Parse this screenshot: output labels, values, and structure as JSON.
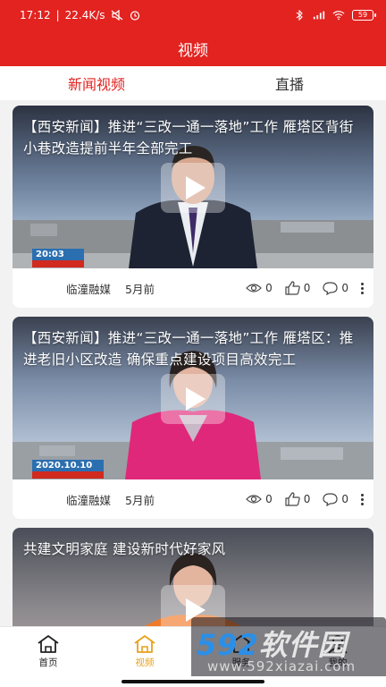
{
  "status_bar": {
    "time": "17:12",
    "speed": "22.4K/s",
    "battery": "59"
  },
  "header": {
    "title": "视频"
  },
  "tabs": [
    {
      "label": "新闻视频",
      "active": true
    },
    {
      "label": "直播",
      "active": false
    }
  ],
  "feed": [
    {
      "title": "【西安新闻】推进“三改一通一落地”工作 雁塔区背街小巷改造提前半年全部完工",
      "overlay_date": "20:03",
      "source": "临潼融媒",
      "time": "5月前",
      "views": "0",
      "likes": "0",
      "comments": "0"
    },
    {
      "title": "【西安新闻】推进“三改一通一落地”工作 雁塔区：推进老旧小区改造 确保重点建设项目高效完工",
      "overlay_date": "2020.10.10",
      "source": "临潼融媒",
      "time": "5月前",
      "views": "0",
      "likes": "0",
      "comments": "0"
    },
    {
      "title": "共建文明家庭 建设新时代好家风",
      "overlay_date": "",
      "source": "",
      "time": "",
      "views": "",
      "likes": "",
      "comments": ""
    }
  ],
  "bottom_nav": [
    {
      "label": "首页",
      "icon": "home-icon",
      "active": false
    },
    {
      "label": "视频",
      "icon": "video-home-icon",
      "active": true
    },
    {
      "label": "服务",
      "icon": "service-icon",
      "active": false
    },
    {
      "label": "我的",
      "icon": "profile-icon",
      "active": false
    }
  ],
  "watermark": {
    "brand_num": "592",
    "brand_cn": "软件园",
    "url": "www.592xiazai.com"
  },
  "colors": {
    "brand_red": "#e22320",
    "nav_active": "#e8a11b"
  }
}
